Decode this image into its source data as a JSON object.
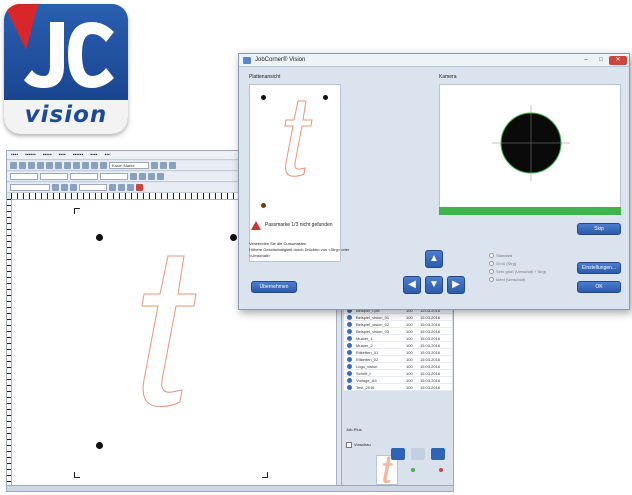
{
  "logo": {
    "text": "vision"
  },
  "back_window": {
    "toolbar_select": "Kaum Marke",
    "zoom_value": "100%"
  },
  "dialog": {
    "title": "JobCorner® Vision",
    "left_panel_label": "Plattenansicht",
    "right_panel_label": "Kamera",
    "warning_text": "Passmarke 1/3 nicht gefunden",
    "skip_button": "Skip",
    "instructions_line1": "Verwenden Sie die Cursortasten",
    "instructions_line2": "Höhere Geschwindigkeit durch Drücken von <Strg> oder",
    "instructions_line3": "<Umschalt>",
    "apply_button": "Übernehmen",
    "radio_options": [
      "Standard",
      "Groß (Strg)",
      "Sehr groß (Umschalt + Strg)",
      "Ident (Umschalt)"
    ],
    "settings_button": "Einstellungen...",
    "ok_button": "OK"
  },
  "side_panel": {
    "section_label": "Job-Plus",
    "checkbox_label": "Vorschau",
    "file_rows": [
      {
        "name": "Beispiel_t.plx",
        "size": "100",
        "date": "15.03.2016"
      },
      {
        "name": "Beispiel_vision_01",
        "size": "100",
        "date": "15.03.2016"
      },
      {
        "name": "Beispiel_vision_02",
        "size": "100",
        "date": "15.03.2016"
      },
      {
        "name": "Beispiel_vision_03",
        "size": "100",
        "date": "15.03.2016"
      },
      {
        "name": "Muster_1",
        "size": "100",
        "date": "15.03.2016"
      },
      {
        "name": "Muster_2",
        "size": "100",
        "date": "15.03.2016"
      },
      {
        "name": "Etiketten_01",
        "size": "100",
        "date": "15.03.2016"
      },
      {
        "name": "Etiketten_02",
        "size": "100",
        "date": "15.03.2016"
      },
      {
        "name": "Logo_vision",
        "size": "100",
        "date": "15.03.2016"
      },
      {
        "name": "Schrift_t",
        "size": "100",
        "date": "15.03.2016"
      },
      {
        "name": "Vorlage_A4",
        "size": "100",
        "date": "15.03.2016"
      },
      {
        "name": "Test_2016",
        "size": "100",
        "date": "15.03.2016"
      }
    ]
  },
  "colors": {
    "accent_blue": "#2b5aa8",
    "warning_red": "#c73a2e",
    "camera_ok_green": "#3cb54a",
    "letter_outline": "#e8957a"
  }
}
